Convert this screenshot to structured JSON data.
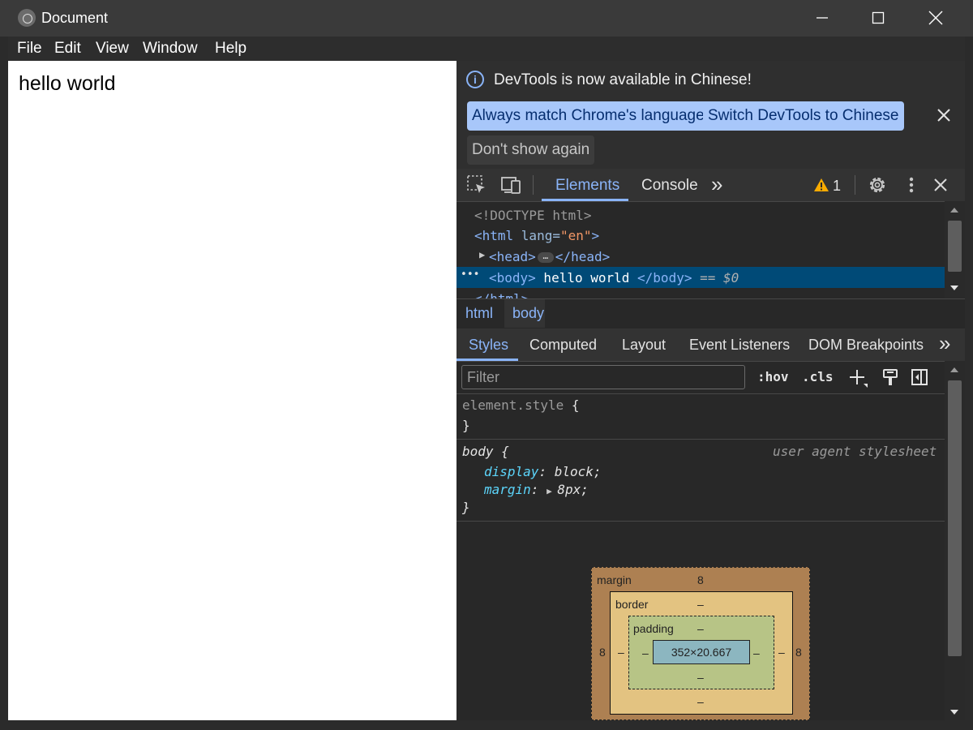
{
  "window": {
    "title": "Document",
    "minimize": "—",
    "maximize": "☐",
    "close": "✕"
  },
  "menu": {
    "items": [
      "File",
      "Edit",
      "View",
      "Window",
      "Help"
    ]
  },
  "page": {
    "content": "hello world"
  },
  "devtools": {
    "infobar": {
      "message": "DevTools is now available in Chinese!",
      "btn_match": "Always match Chrome's language",
      "btn_switch": "Switch DevTools to Chinese",
      "btn_dont_show": "Don't show again"
    },
    "tabs": {
      "elements": "Elements",
      "console": "Console",
      "more": "»",
      "warning_count": "1"
    },
    "dom": {
      "doctype": "<!DOCTYPE html>",
      "html_open": "<html ",
      "html_attr_name": "lang=",
      "html_attr_value": "\"en\"",
      "html_close_bracket": ">",
      "head_open": "<head>",
      "head_close": "</head>",
      "body_open": "<body>",
      "body_text": " hello world ",
      "body_close": "</body>",
      "selected_marker": " == $0",
      "html_end": "</html>"
    },
    "breadcrumb": [
      "html",
      "body"
    ],
    "style_tabs": [
      "Styles",
      "Computed",
      "Layout",
      "Event Listeners",
      "DOM Breakpoints"
    ],
    "style_tabs_more": "»",
    "filter": {
      "placeholder": "Filter",
      "hov": ":hov",
      "cls": ".cls"
    },
    "rules": {
      "element_selector": "element.style",
      "open_brace": " {",
      "close_brace": "}",
      "body_selector": "body",
      "ua_label": "user agent stylesheet",
      "prop1_name": "display",
      "prop1_value": "block;",
      "prop2_name": "margin",
      "prop2_value": "8px;"
    },
    "box_model": {
      "margin_label": "margin",
      "margin_top": "8",
      "margin_left": "8",
      "margin_right": "8",
      "border_label": "border",
      "border_top": "–",
      "border_left": "–",
      "border_right": "–",
      "border_bottom": "–",
      "padding_label": "padding",
      "padding_top": "–",
      "padding_left": "–",
      "padding_right": "–",
      "padding_bottom": "–",
      "content_size": "352×20.667"
    }
  },
  "colors": {
    "accent_blue": "#8ab4f8",
    "selected_row": "#004a77",
    "warning": "#f9ab00",
    "margin_box": "#ad8052",
    "border_box": "#e3c381",
    "padding_box": "#b7c486",
    "content_box": "#8cb6c0"
  }
}
